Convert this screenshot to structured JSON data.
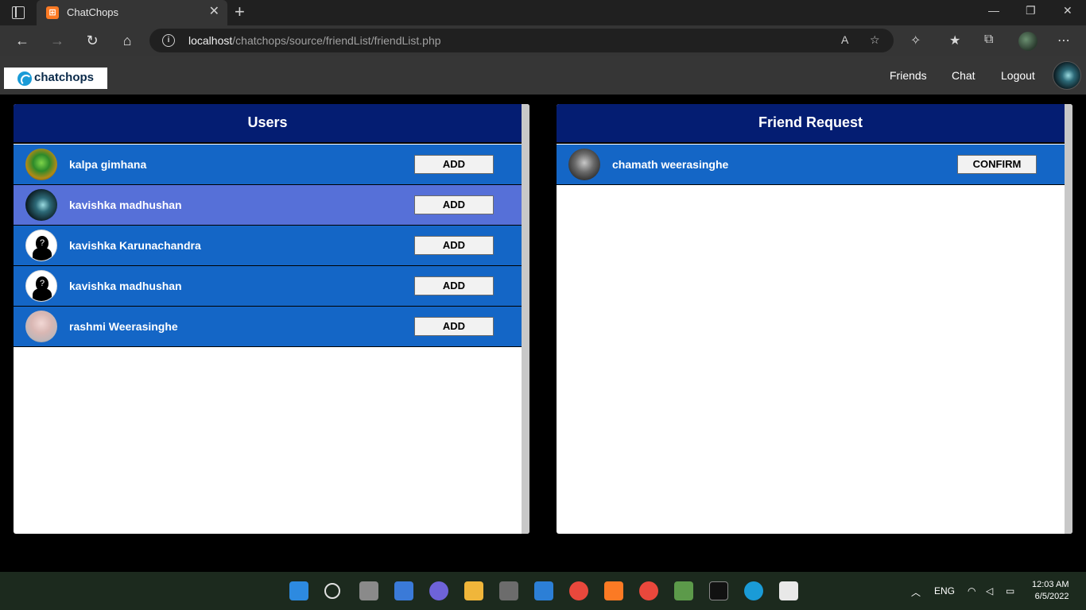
{
  "browser": {
    "tab_title": "ChatChops",
    "tab_favicon_glyph": "⊞",
    "url_host": "localhost",
    "url_path": "/chatchops/source/friendList/friendList.php"
  },
  "app": {
    "logo_text": "chatchops",
    "nav": {
      "friends": "Friends",
      "chat": "Chat",
      "logout": "Logout"
    }
  },
  "users_panel": {
    "title": "Users",
    "button_label": "ADD",
    "users": [
      {
        "name": "kalpa gimhana",
        "avatar": "green-profile-photo",
        "highlighted": false
      },
      {
        "name": "kavishka madhushan",
        "avatar": "dark-profile-photo",
        "highlighted": true
      },
      {
        "name": "kavishka Karunachandra",
        "avatar": "default-silhouette",
        "highlighted": false
      },
      {
        "name": "kavishka madhushan",
        "avatar": "default-silhouette",
        "highlighted": false
      },
      {
        "name": "rashmi Weerasinghe",
        "avatar": "girl-profile-photo",
        "highlighted": false
      }
    ]
  },
  "requests_panel": {
    "title": "Friend Request",
    "button_label": "CONFIRM",
    "requests": [
      {
        "name": "chamath weerasinghe",
        "avatar": "bearded-man-photo"
      }
    ]
  },
  "taskbar": {
    "language": "ENG",
    "time": "12:03 AM",
    "date": "6/5/2022"
  },
  "colors": {
    "panel_header": "#041d72",
    "row": "#1466c6",
    "row_highlight": "#5670d8"
  }
}
